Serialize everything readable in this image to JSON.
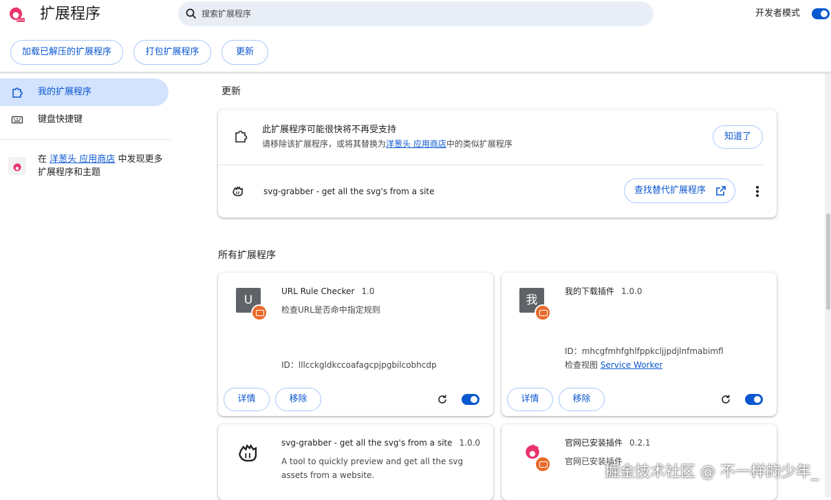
{
  "header": {
    "title": "扩展程序",
    "search_placeholder": "搜索扩展程序",
    "dev_mode_label": "开发者模式",
    "dev_mode_on": true
  },
  "toolbar": {
    "load_unpacked": "加载已解压的扩展程序",
    "pack": "打包扩展程序",
    "update": "更新"
  },
  "sidebar": {
    "items": [
      {
        "label": "我的扩展程序",
        "icon": "puzzle-icon",
        "active": true
      },
      {
        "label": "键盘快捷键",
        "icon": "keyboard-icon",
        "active": false
      }
    ],
    "promo": {
      "prefix": "在",
      "link": "洋葱头 应用商店",
      "suffix": "中发现更多扩展程序和主题"
    }
  },
  "updates_section": {
    "title": "更新",
    "warning_title": "此扩展程序可能很快将不再受支持",
    "warning_desc_prefix": "请移除该扩展程序，或将其替换为",
    "warning_desc_link": "洋葱头 应用商店",
    "warning_desc_suffix": "中的类似扩展程序",
    "ok_button": "知道了",
    "extension_name": "svg-grabber - get all the svg's from a site",
    "find_alternative": "查找替代扩展程序"
  },
  "all_section": {
    "title": "所有扩展程序",
    "extensions": [
      {
        "avatar": "U",
        "name": "URL Rule Checker",
        "version": "1.0",
        "description": "检查URL是否命中指定规则",
        "id_label": "ID：",
        "id": "lllcckgldkccoafagcpjpgbilcobhcdp",
        "details": "详情",
        "remove": "移除",
        "enabled": true
      },
      {
        "avatar": "我",
        "name": "我的下载插件",
        "version": "1.0.0",
        "id_label": "ID：",
        "id": "mhcgfmhfghlfppkcljjpdjlnfmabimfl",
        "inspect_label": "检查视图",
        "inspect_link": "Service Worker",
        "details": "详情",
        "remove": "移除",
        "enabled": true
      },
      {
        "name": "svg-grabber - get all the svg's from a site",
        "version": "1.0.0",
        "description": "A tool to quickly preview and get all the svg assets from a website."
      },
      {
        "name": "官网已安装插件",
        "version": "0.2.1",
        "description": "官网已安装插件"
      }
    ]
  },
  "watermark": "掘金技术社区 @ 不一样的少年_",
  "colors": {
    "accent": "#0b57d0",
    "active_bg": "#d3e3fd",
    "search_bg": "#e9eef6",
    "badge": "#ea6a2b"
  }
}
